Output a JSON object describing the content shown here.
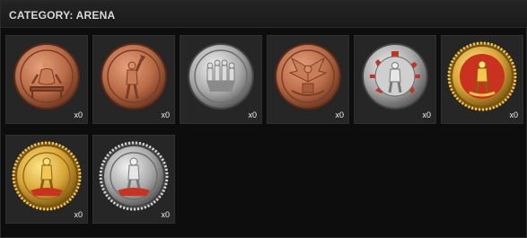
{
  "category": {
    "title": "CATEGORY: ARENA"
  },
  "medals": [
    {
      "id": "medal-1",
      "metal": "bronze",
      "motif": "seated-figure",
      "count": "x0"
    },
    {
      "id": "medal-2",
      "metal": "bronze",
      "motif": "raised-arm-figure",
      "count": "x0"
    },
    {
      "id": "medal-3",
      "metal": "silver",
      "motif": "group-of-figures",
      "count": "x0"
    },
    {
      "id": "medal-4",
      "metal": "bronze",
      "motif": "eagle-emblem",
      "count": "x0"
    },
    {
      "id": "medal-5",
      "metal": "silver-red",
      "motif": "standing-figure",
      "count": "x0"
    },
    {
      "id": "medal-6",
      "metal": "gold-red",
      "motif": "standing-figure",
      "count": "x0"
    },
    {
      "id": "medal-7",
      "metal": "gold",
      "motif": "standing-figure-on-bodies",
      "count": "x0"
    },
    {
      "id": "medal-8",
      "metal": "silver-red",
      "motif": "standing-figure-on-bodies",
      "count": "x0"
    }
  ],
  "colors": {
    "bronze": "#b86a45",
    "silver": "#b9b9b9",
    "gold": "#d7a536",
    "red": "#c8321f"
  }
}
